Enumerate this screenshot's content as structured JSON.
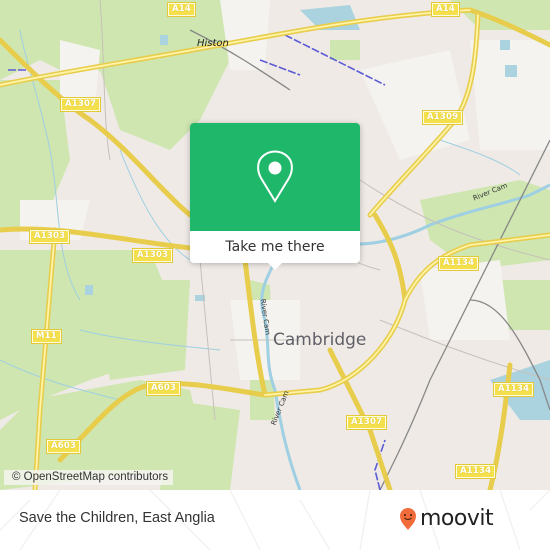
{
  "map": {
    "place_labels": {
      "histon": "Histon",
      "cambridge": "Cambridge"
    },
    "road_labels": {
      "a14_left": "A14",
      "a14_right": "A14",
      "a1307_top": "A1307",
      "a1309": "A1309",
      "a1303_left": "A1303",
      "a1303_mid": "A1303",
      "m11": "M11",
      "a603_mid": "A603",
      "a603_low": "A603",
      "a1134_mid": "A1134",
      "a1134_right": "A1134",
      "a1307_bottom": "A1307",
      "a1134_bottom": "A1134"
    },
    "river_labels": {
      "north": "River Cam",
      "center": "River Cam",
      "south": "River Cam"
    },
    "attribution": "© OpenStreetMap contributors"
  },
  "popup": {
    "icon": "map-pin-icon",
    "button_label": "Take me there",
    "color": "#1fb76a"
  },
  "footer": {
    "place_name": "Save the Children, East Anglia",
    "brand": "moovit",
    "brand_color": "#f26b3a"
  }
}
